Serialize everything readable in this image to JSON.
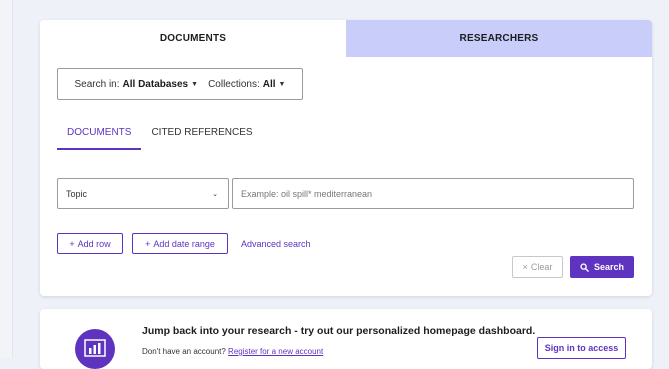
{
  "top_tabs": {
    "documents": "DOCUMENTS",
    "researchers": "RESEARCHERS"
  },
  "search_in": {
    "label": "Search in:",
    "value": "All Databases",
    "collections_label": "Collections:",
    "collections_value": "All"
  },
  "sub_tabs": {
    "documents": "DOCUMENTS",
    "cited_references": "CITED REFERENCES"
  },
  "search_row": {
    "field_value": "Topic",
    "placeholder": "Example: oil spill* mediterranean"
  },
  "actions": {
    "add_row": "Add row",
    "add_date_range": "Add date range",
    "advanced_search": "Advanced search",
    "clear": "Clear",
    "search": "Search"
  },
  "promo": {
    "title": "Jump back into your research - try out our personalized homepage dashboard.",
    "no_account": "Don't have an account?",
    "register_link": "Register for a new account",
    "sign_in": "Sign in to access"
  },
  "colors": {
    "accent": "#5e33bf",
    "researchers_tab_bg": "#c8cdfa",
    "page_bg": "#eef1f7"
  }
}
